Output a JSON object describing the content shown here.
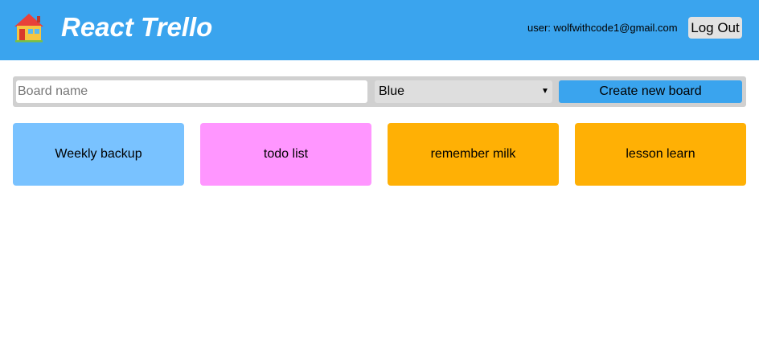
{
  "header": {
    "title": "React Trello",
    "logo_icon": "house-icon",
    "user_label": "user: wolfwithcode1@gmail.com",
    "logout_label": "Log Out",
    "background": "#3aa4ee"
  },
  "create_board": {
    "name_placeholder": "Board name",
    "name_value": "",
    "selected_color": "Blue",
    "create_label": "Create new board"
  },
  "boards": [
    {
      "title": "Weekly backup",
      "color": "#79c2ff"
    },
    {
      "title": "todo list",
      "color": "#ff96ff"
    },
    {
      "title": "remember milk",
      "color": "#ffb005"
    },
    {
      "title": "lesson learn",
      "color": "#ffb005"
    }
  ]
}
